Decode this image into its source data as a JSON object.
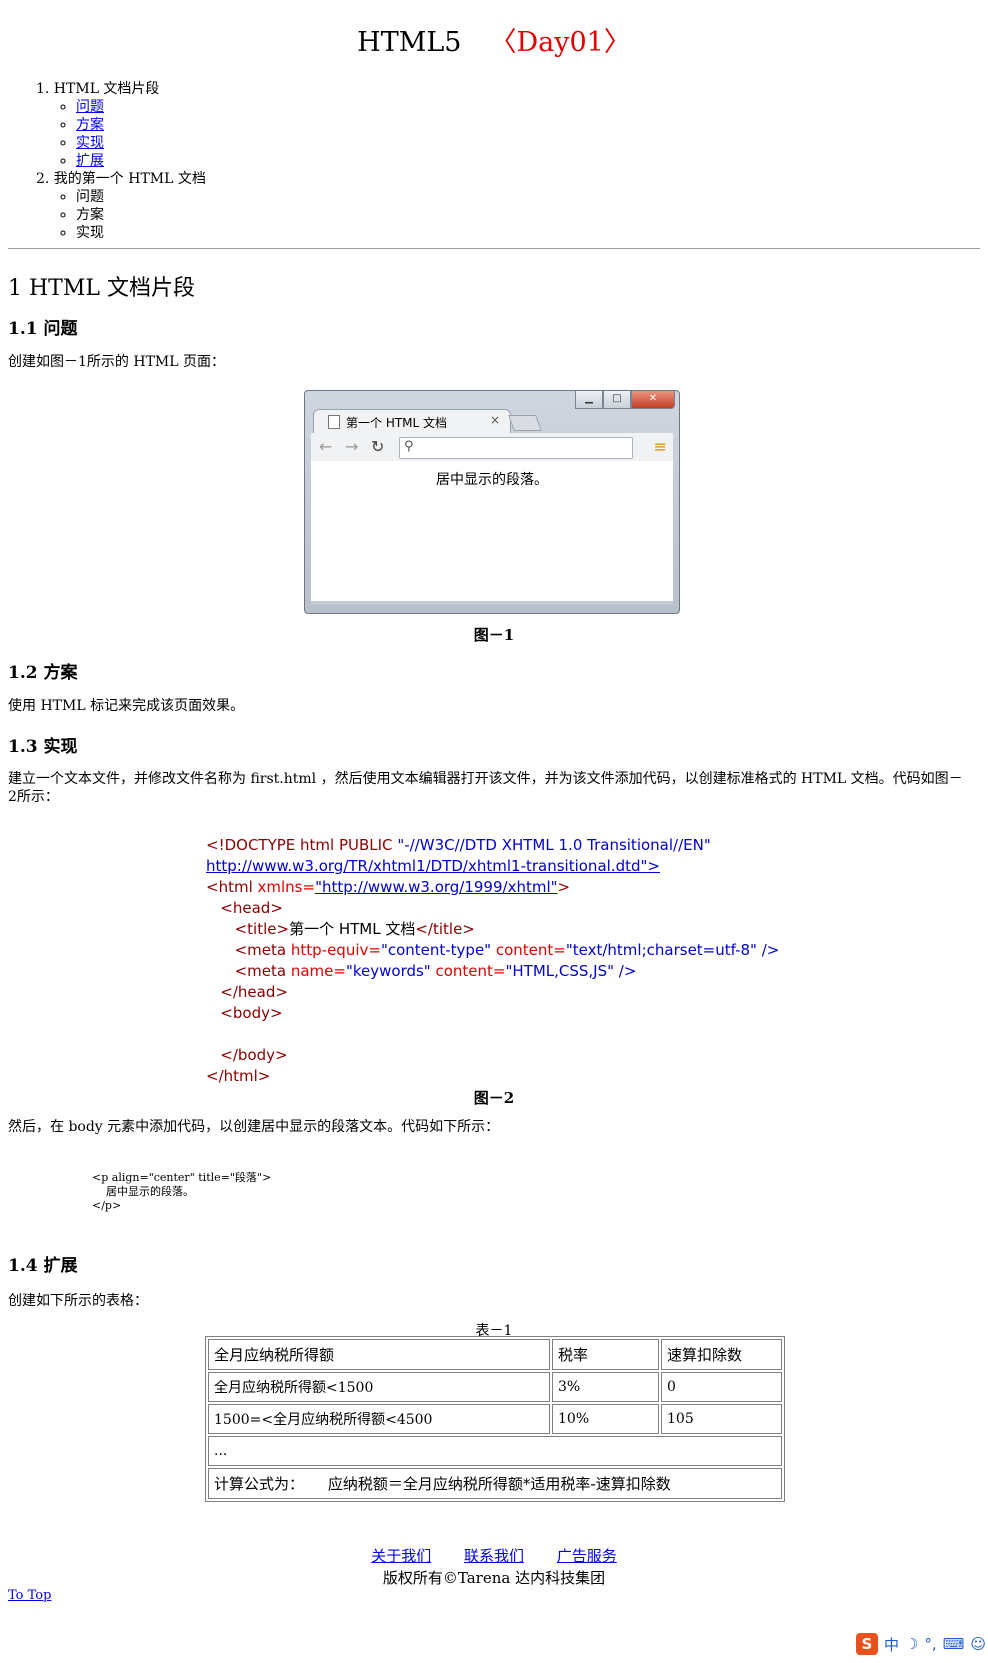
{
  "header": {
    "title": "HTML5",
    "day": "〈Day01〉"
  },
  "toc": {
    "items": [
      {
        "label": "1.  HTML 文档片段",
        "subs": [
          "问题",
          "方案",
          "实现",
          "扩展"
        ]
      },
      {
        "label": "2.  我的第一个 HTML 文档",
        "subs": [
          "问题",
          "方案",
          "实现"
        ]
      }
    ]
  },
  "section1": {
    "heading": "1   HTML 文档片段",
    "s1_1": {
      "heading": "1.1  问题",
      "text": "创建如图－1所示的 HTML 页面：",
      "caption": "图－1"
    },
    "s1_2": {
      "heading": "1.2  方案",
      "text": "使用 HTML 标记来完成该页面效果。"
    },
    "s1_3": {
      "heading": "1.3  实现",
      "text": "建立一个文本文件，并修改文件名称为  first.html  ，然后使用文本编辑器打开该文件，并为该文件添加代码，以创建标准格式的 HTML 文档。代码如图－2所示：",
      "caption": "图－2",
      "text2": "然后，在 body 元素中添加代码，以创建居中显示的段落文本。代码如下所示：",
      "snippet": "<p align=\"center\" title=\"段落\">\n    居中显示的段落。\n</p>"
    },
    "s1_4": {
      "heading": "1.4  扩展",
      "text": "创建如下所示的表格："
    }
  },
  "browser": {
    "tab_title": "第一个 HTML 文档",
    "content": "居中显示的段落。",
    "btn_min": "▁",
    "btn_max": "□",
    "btn_close": "✕"
  },
  "code": {
    "l1a": "<!DOCTYPE html PUBLIC ",
    "l1b": "\"-//W3C//DTD XHTML 1.0 Transitional//EN\"",
    "l2": "http://www.w3.org/TR/xhtml1/DTD/xhtml1-transitional.dtd\">",
    "l3a": "<html ",
    "l3b": "xmlns=",
    "l3c": "\"http://www.w3.org/1999/xhtml\"",
    "l3d": ">",
    "l4": "   <head>",
    "l5a": "      <title>",
    "l5b": "第一个 HTML 文档",
    "l5c": "</title>",
    "l6a": "      <meta ",
    "l6b": "http-equiv=",
    "l6c": "\"content-type\"",
    "l6d": " content=",
    "l6e": "\"text/html;charset=utf-8\"",
    "l6f": " />",
    "l7a": "      <meta ",
    "l7b": "name=",
    "l7c": "\"keywords\"",
    "l7d": " content=",
    "l7e": "\"HTML,CSS,JS\"",
    "l7f": " />",
    "l8": "   </head>",
    "l9": "   <body>",
    "l10": "",
    "l11": "   </body>",
    "l12": "</html>"
  },
  "table": {
    "caption": "表－1",
    "header": [
      "全月应纳税所得额",
      "税率",
      "速算扣除数"
    ],
    "rows": [
      [
        "全月应纳税所得额<1500",
        "3%",
        "0"
      ],
      [
        "1500=<全月应纳税所得额<4500",
        "10%",
        "105"
      ]
    ],
    "ellipsis": "...",
    "formula": "计算公式为：     应纳税额＝全月应纳税所得额*适用税率-速算扣除数"
  },
  "footer": {
    "links": [
      "关于我们",
      "联系我们",
      "广告服务"
    ],
    "copyright": "版权所有©Tarena 达内科技集团",
    "to_top": "To Top"
  },
  "ime": {
    "brand": "S",
    "mode": "中"
  }
}
